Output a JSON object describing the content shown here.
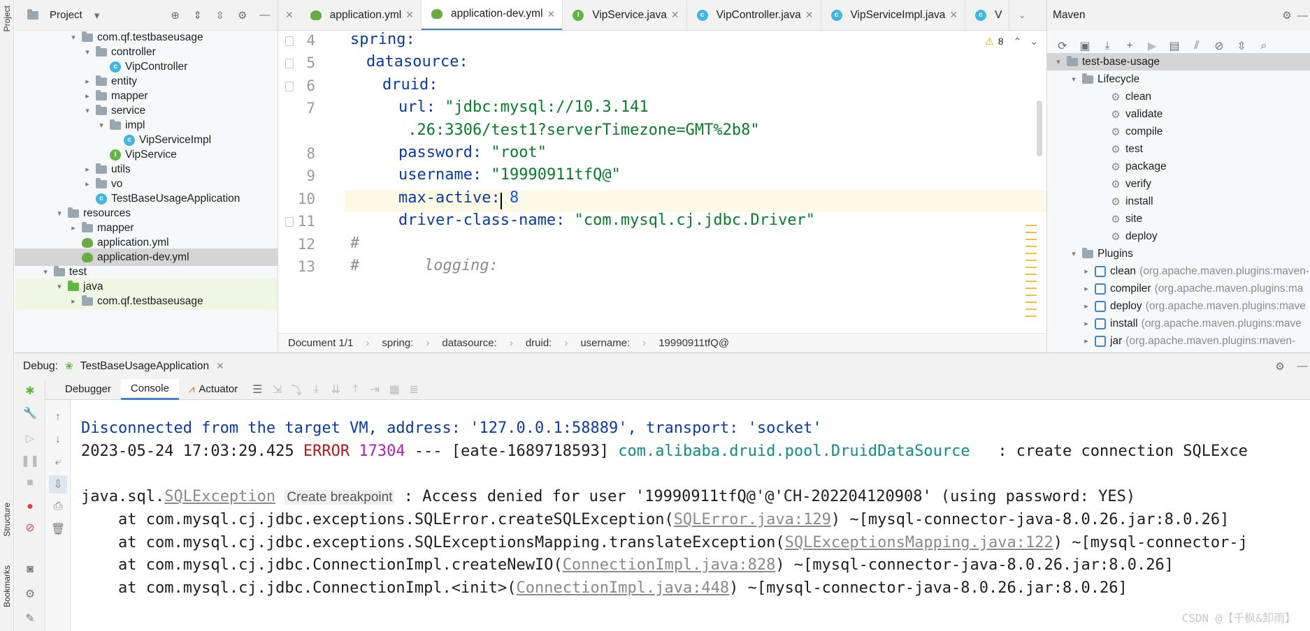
{
  "left_stripe": {
    "project": "Project",
    "structure": "Structure",
    "bookmarks": "Bookmarks"
  },
  "project_panel": {
    "title": "Project",
    "tree": [
      {
        "label": "com.qf.testbaseusage",
        "kind": "package",
        "arrow": "v"
      },
      {
        "label": "controller",
        "kind": "package",
        "arrow": "v"
      },
      {
        "label": "VipController",
        "kind": "class",
        "arrow": ""
      },
      {
        "label": "entity",
        "kind": "package",
        "arrow": ">"
      },
      {
        "label": "mapper",
        "kind": "package",
        "arrow": ">"
      },
      {
        "label": "service",
        "kind": "package",
        "arrow": "v"
      },
      {
        "label": "impl",
        "kind": "package",
        "arrow": "v"
      },
      {
        "label": "VipServiceImpl",
        "kind": "class",
        "arrow": ""
      },
      {
        "label": "VipService",
        "kind": "interface",
        "arrow": ""
      },
      {
        "label": "utils",
        "kind": "package",
        "arrow": ">"
      },
      {
        "label": "vo",
        "kind": "package",
        "arrow": ">"
      },
      {
        "label": "TestBaseUsageApplication",
        "kind": "class",
        "arrow": ""
      },
      {
        "label": "resources",
        "kind": "folder",
        "arrow": "v"
      },
      {
        "label": "mapper",
        "kind": "folder",
        "arrow": ">"
      },
      {
        "label": "application.yml",
        "kind": "yml",
        "arrow": ""
      },
      {
        "label": "application-dev.yml",
        "kind": "yml",
        "arrow": "",
        "selected": true
      },
      {
        "label": "test",
        "kind": "folder",
        "arrow": "v"
      },
      {
        "label": "java",
        "kind": "test-folder",
        "arrow": "v"
      },
      {
        "label": "com.qf.testbaseusage",
        "kind": "package",
        "arrow": ">"
      }
    ]
  },
  "tabs": [
    {
      "label": "application.yml",
      "icon": "yml-icon"
    },
    {
      "label": "application-dev.yml",
      "icon": "yml-icon",
      "active": true
    },
    {
      "label": "VipService.java",
      "icon": "interface-icon"
    },
    {
      "label": "VipController.java",
      "icon": "class-icon"
    },
    {
      "label": "VipServiceImpl.java",
      "icon": "class-icon"
    },
    {
      "label": "V",
      "icon": "class-icon"
    }
  ],
  "editor": {
    "inspection_count": "8",
    "lines": [
      {
        "num": "4",
        "indent": 0,
        "key": "spring",
        "sep": ":",
        "val": ""
      },
      {
        "num": "5",
        "indent": 1,
        "key": "datasource",
        "sep": ":",
        "val": ""
      },
      {
        "num": "6",
        "indent": 2,
        "key": "druid",
        "sep": ":",
        "val": ""
      },
      {
        "num": "7",
        "indent": 3,
        "key": "url",
        "sep": ": ",
        "val": "\"jdbc:mysql://10.3.141"
      },
      {
        "num": "",
        "indent": 3,
        "key": "",
        "sep": "",
        "val": " .26:3306/test1?serverTimezone=GMT%2b8\""
      },
      {
        "num": "8",
        "indent": 3,
        "key": "password",
        "sep": ": ",
        "val": "\"root\""
      },
      {
        "num": "9",
        "indent": 3,
        "key": "username",
        "sep": ": ",
        "val": "\"19990911tfQ@\""
      },
      {
        "num": "10",
        "indent": 3,
        "key": "max-active",
        "sep": ": ",
        "val": "8"
      },
      {
        "num": "11",
        "indent": 3,
        "key": "driver-class-name",
        "sep": ": ",
        "val": "\"com.mysql.cj.jdbc.Driver\""
      },
      {
        "num": "12",
        "indent": 0,
        "comment": "#"
      },
      {
        "num": "13",
        "indent": 0,
        "comment": "#       logging:"
      }
    ]
  },
  "breadcrumb": [
    "Document 1/1",
    "spring:",
    "datasource:",
    "druid:",
    "username:",
    "19990911tfQ@"
  ],
  "maven": {
    "title": "Maven",
    "project": "test-base-usage",
    "lifecycle_label": "Lifecycle",
    "lifecycle": [
      "clean",
      "validate",
      "compile",
      "test",
      "package",
      "verify",
      "install",
      "site",
      "deploy"
    ],
    "plugins_label": "Plugins",
    "plugins": [
      {
        "name": "clean",
        "coord": "(org.apache.maven.plugins:maven-"
      },
      {
        "name": "compiler",
        "coord": "(org.apache.maven.plugins:ma"
      },
      {
        "name": "deploy",
        "coord": "(org.apache.maven.plugins:mave"
      },
      {
        "name": "install",
        "coord": "(org.apache.maven.plugins:mave"
      },
      {
        "name": "jar",
        "coord": "(org.apache.maven.plugins:maven-"
      }
    ]
  },
  "debug": {
    "label": "Debug:",
    "session": "TestBaseUsageApplication",
    "tabs": [
      "Debugger",
      "Console",
      "Actuator"
    ],
    "active_tab": "Console"
  },
  "console": {
    "line1": "Disconnected from the target VM, address: '127.0.0.1:58889', transport: 'socket'",
    "line2": {
      "time": "2023-05-24 17:03:29.425 ",
      "level": "ERROR",
      "pid": " 17304",
      "thread": " --- [eate-1689718593] ",
      "logger": "com.alibaba.druid.pool.DruidDataSource",
      "msg": "   : create connection SQLExce"
    },
    "line3": {
      "prefix": "java.sql.",
      "exc": "SQLException",
      "chip": "Create breakpoint",
      "msg": " : Access denied for user '19990911tfQ@'@'CH-202204120908' (using password: YES)"
    },
    "stack": [
      {
        "at": "    at com.mysql.cj.jdbc.exceptions.SQLError.createSQLException(",
        "link": "SQLError.java:129",
        "tail": ") ~[mysql-connector-java-8.0.26.jar:8.0.26]"
      },
      {
        "at": "    at com.mysql.cj.jdbc.exceptions.SQLExceptionsMapping.translateException(",
        "link": "SQLExceptionsMapping.java:122",
        "tail": ") ~[mysql-connector-j"
      },
      {
        "at": "    at com.mysql.cj.jdbc.ConnectionImpl.createNewIO(",
        "link": "ConnectionImpl.java:828",
        "tail": ") ~[mysql-connector-java-8.0.26.jar:8.0.26]"
      },
      {
        "at": "    at com.mysql.cj.jdbc.ConnectionImpl.<init>(",
        "link": "ConnectionImpl.java:448",
        "tail": ") ~[mysql-connector-java-8.0.26.jar:8.0.26]"
      }
    ]
  },
  "watermark": "CSDN @【千枫&卸雨】"
}
